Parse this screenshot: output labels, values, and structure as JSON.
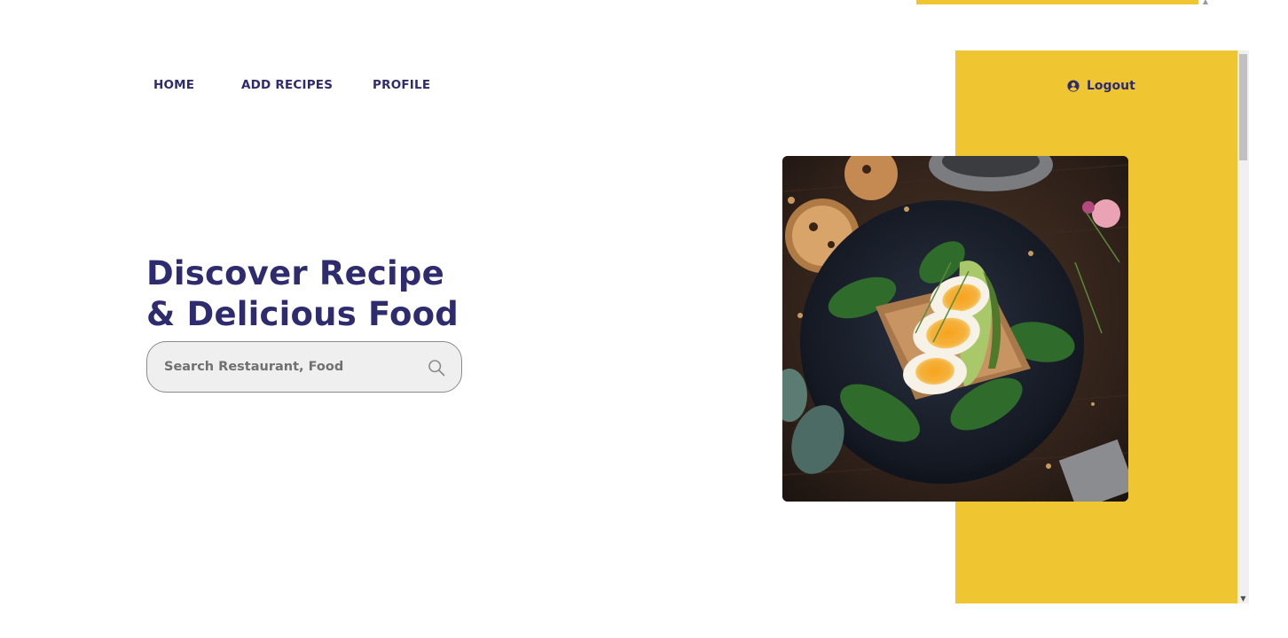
{
  "colors": {
    "accent": "#EFC632",
    "ink": "#2E2C6E"
  },
  "nav": {
    "items": [
      {
        "label": "HOME"
      },
      {
        "label": "ADD RECIPES"
      },
      {
        "label": "PROFILE"
      }
    ]
  },
  "account": {
    "logout_label": "Logout",
    "logout_icon": "user-circle-icon"
  },
  "hero": {
    "title_line1": "Discover Recipe",
    "title_line2": "& Delicious Food",
    "search": {
      "placeholder": "Search Restaurant, Food",
      "value": "",
      "icon": "search-icon"
    },
    "image": {
      "description_icon": "food-photo"
    }
  }
}
